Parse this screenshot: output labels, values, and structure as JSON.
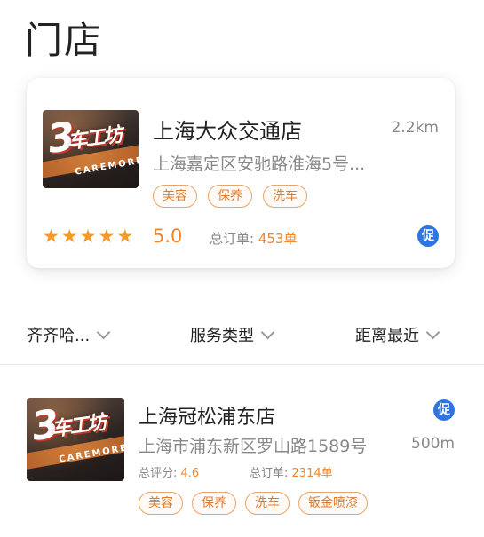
{
  "page": {
    "title": "门店"
  },
  "featured_store": {
    "name": "上海大众交通店",
    "distance": "2.2km",
    "address": "上海嘉定区安驰路淮海5号...",
    "tags": [
      "美容",
      "保养",
      "洗车"
    ],
    "rating": 5,
    "rating_text": "5.0",
    "orders_label": "总订单:",
    "orders_value": "453单",
    "promo": "促",
    "thumbnail_logo_main": "车工坊",
    "thumbnail_logo_num": "3",
    "thumbnail_logo_sub": "CAREMORE"
  },
  "filters": [
    {
      "label": "齐齐哈..."
    },
    {
      "label": "服务类型"
    },
    {
      "label": "距离最近"
    }
  ],
  "stores": [
    {
      "name": "上海冠松浦东店",
      "promo": "促",
      "address": "上海市浦东新区罗山路1589号",
      "distance": "500m",
      "score_label": "总评分:",
      "score_value": "4.6",
      "orders_label": "总订单:",
      "orders_value": "2314单",
      "tags": [
        "美容",
        "保养",
        "洗车",
        "钣金喷漆"
      ],
      "thumbnail_logo_main": "车工坊",
      "thumbnail_logo_num": "3",
      "thumbnail_logo_sub": "CAREMORE"
    }
  ],
  "colors": {
    "accent": "#f0852a",
    "tag_border": "#e8a56a",
    "promo": "#2f75e0",
    "star": "#f39a2b"
  },
  "icons": {
    "star": "star-icon",
    "chevron": "chevron-down-icon",
    "promo": "promo-badge-icon"
  }
}
